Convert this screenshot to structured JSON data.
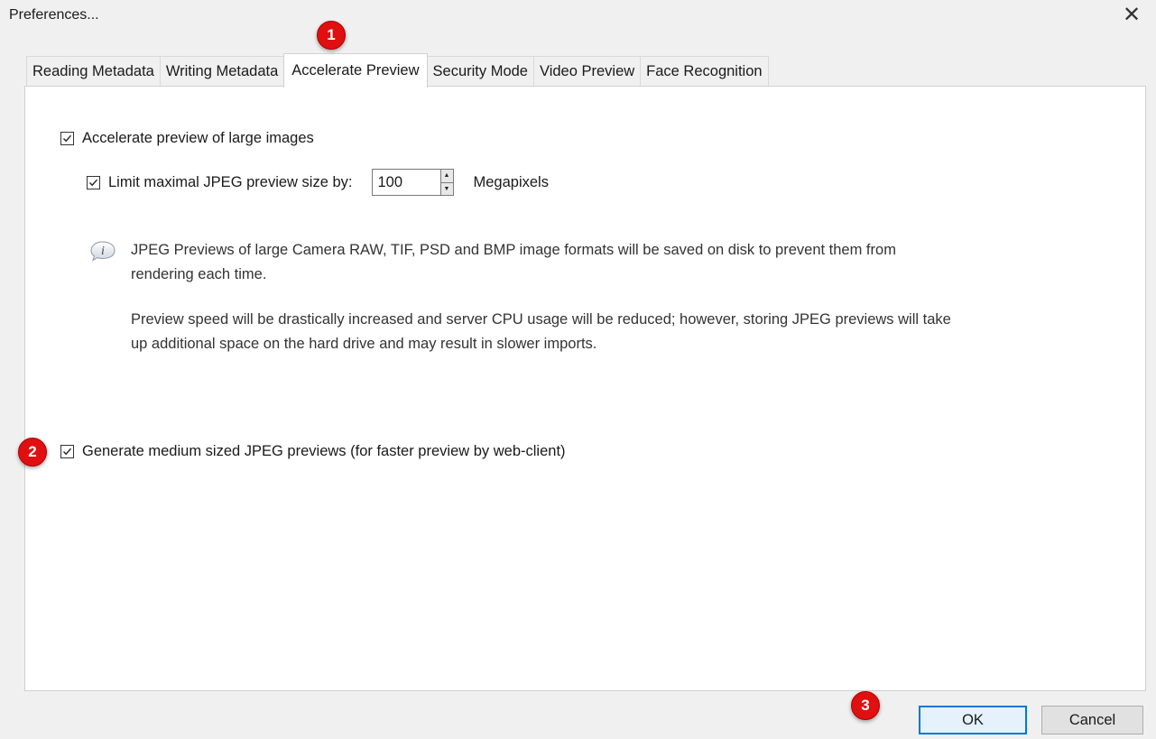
{
  "window": {
    "title": "Preferences...",
    "close_glyph": "✕"
  },
  "tabs": [
    {
      "label": "Reading Metadata",
      "active": false
    },
    {
      "label": "Writing Metadata",
      "active": false
    },
    {
      "label": "Accelerate Preview",
      "active": true
    },
    {
      "label": "Security Mode",
      "active": false
    },
    {
      "label": "Video Preview",
      "active": false
    },
    {
      "label": "Face Recognition",
      "active": false
    }
  ],
  "panel": {
    "accelerate_preview": {
      "label": "Accelerate preview of large images",
      "checked": true
    },
    "limit_jpeg": {
      "label": "Limit maximal JPEG preview size by:",
      "checked": true,
      "value": "100",
      "unit": "Megapixels"
    },
    "info": {
      "icon": "info-icon",
      "line1": "JPEG Previews of large Camera RAW, TIF, PSD and BMP image formats will be saved on disk to prevent them from",
      "line2": "rendering each time.",
      "line3": "Preview speed will be drastically increased and server CPU usage will be reduced; however, storing JPEG previews will take",
      "line4": "up additional space on the hard drive and may result in slower imports."
    },
    "medium_previews": {
      "label": "Generate medium sized JPEG previews (for faster preview by web-client)",
      "checked": true
    }
  },
  "buttons": {
    "ok": "OK",
    "cancel": "Cancel"
  },
  "markers": {
    "m1": "1",
    "m2": "2",
    "m3": "3"
  },
  "colors": {
    "marker_red": "#e01010",
    "default_button_border": "#0078d7"
  }
}
